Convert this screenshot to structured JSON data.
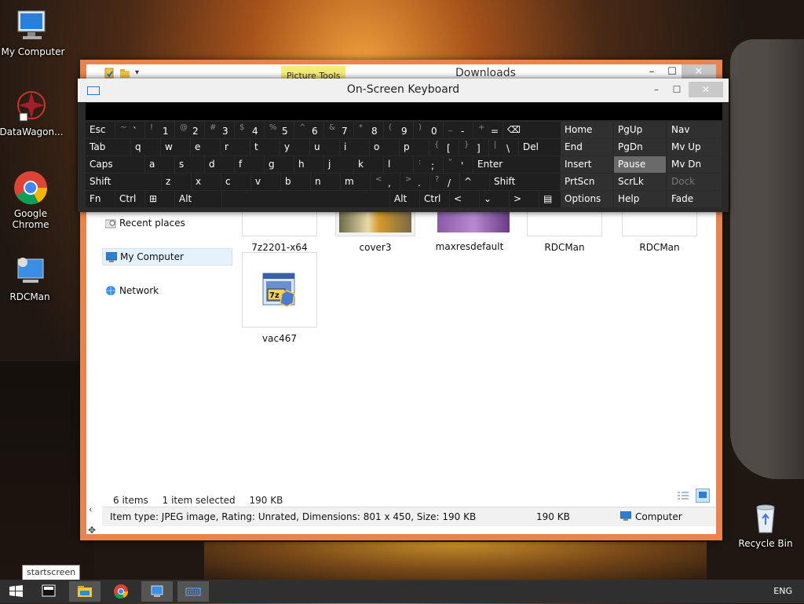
{
  "desktop": {
    "icons": [
      {
        "label": "My Computer"
      },
      {
        "label": "DataWagon..."
      },
      {
        "label": "Google Chrome"
      },
      {
        "label": "RDCMan"
      },
      {
        "label": "Recycle Bin"
      }
    ]
  },
  "explorer": {
    "title": "Downloads",
    "contextual_tab": "Picture Tools",
    "controls": {
      "minimize": "–",
      "maximize": "☐",
      "close": "✕"
    },
    "nav": [
      {
        "label": "Recent places"
      },
      {
        "label": "My Computer"
      },
      {
        "label": "Network"
      }
    ],
    "files": [
      {
        "name": "7z2201-x64"
      },
      {
        "name": "cover3"
      },
      {
        "name": "maxresdefault"
      },
      {
        "name": "RDCMan"
      },
      {
        "name": "RDCMan"
      },
      {
        "name": "vac467"
      }
    ],
    "status": {
      "items": "6 items",
      "selected": "1 item selected",
      "size": "190 KB"
    },
    "details": {
      "info": "Item type: JPEG image, Rating: Unrated, Dimensions: 801 x 450, Size: 190 KB",
      "size": "190 KB",
      "location": "Computer"
    }
  },
  "osk": {
    "title": "On-Screen Keyboard",
    "controls": {
      "minimize": "–",
      "maximize": "☐",
      "close": "✕"
    },
    "rows": {
      "r1": [
        {
          "s": "",
          "m": "Esc"
        },
        {
          "s": "~",
          "m": "`"
        },
        {
          "s": "!",
          "m": "1"
        },
        {
          "s": "@",
          "m": "2"
        },
        {
          "s": "#",
          "m": "3"
        },
        {
          "s": "$",
          "m": "4"
        },
        {
          "s": "%",
          "m": "5"
        },
        {
          "s": "^",
          "m": "6"
        },
        {
          "s": "&",
          "m": "7"
        },
        {
          "s": "*",
          "m": "8"
        },
        {
          "s": "(",
          "m": "9"
        },
        {
          "s": ")",
          "m": "0"
        },
        {
          "s": "_",
          "m": "-"
        },
        {
          "s": "+",
          "m": "="
        },
        {
          "s": "",
          "m": "⌫"
        }
      ],
      "r2": [
        {
          "s": "",
          "m": "Tab"
        },
        {
          "s": "",
          "m": "q"
        },
        {
          "s": "",
          "m": "w"
        },
        {
          "s": "",
          "m": "e"
        },
        {
          "s": "",
          "m": "r"
        },
        {
          "s": "",
          "m": "t"
        },
        {
          "s": "",
          "m": "y"
        },
        {
          "s": "",
          "m": "u"
        },
        {
          "s": "",
          "m": "i"
        },
        {
          "s": "",
          "m": "o"
        },
        {
          "s": "",
          "m": "p"
        },
        {
          "s": "{",
          "m": "["
        },
        {
          "s": "}",
          "m": "]"
        },
        {
          "s": "|",
          "m": "\\"
        },
        {
          "s": "",
          "m": "Del"
        }
      ],
      "r3": [
        {
          "s": "",
          "m": "Caps"
        },
        {
          "s": "",
          "m": "a"
        },
        {
          "s": "",
          "m": "s"
        },
        {
          "s": "",
          "m": "d"
        },
        {
          "s": "",
          "m": "f"
        },
        {
          "s": "",
          "m": "g"
        },
        {
          "s": "",
          "m": "h"
        },
        {
          "s": "",
          "m": "j"
        },
        {
          "s": "",
          "m": "k"
        },
        {
          "s": "",
          "m": "l"
        },
        {
          "s": ":",
          "m": ";"
        },
        {
          "s": "\"",
          "m": "'"
        },
        {
          "s": "",
          "m": "Enter"
        }
      ],
      "r4": [
        {
          "s": "",
          "m": "Shift"
        },
        {
          "s": "",
          "m": "z"
        },
        {
          "s": "",
          "m": "x"
        },
        {
          "s": "",
          "m": "c"
        },
        {
          "s": "",
          "m": "v"
        },
        {
          "s": "",
          "m": "b"
        },
        {
          "s": "",
          "m": "n"
        },
        {
          "s": "",
          "m": "m"
        },
        {
          "s": "<",
          "m": ","
        },
        {
          "s": ">",
          "m": "."
        },
        {
          "s": "?",
          "m": "/"
        },
        {
          "s": "",
          "m": "^"
        },
        {
          "s": "",
          "m": "Shift"
        }
      ],
      "r5": [
        {
          "s": "",
          "m": "Fn"
        },
        {
          "s": "",
          "m": "Ctrl"
        },
        {
          "s": "",
          "m": "⊞"
        },
        {
          "s": "",
          "m": "Alt"
        },
        {
          "s": "",
          "m": ""
        },
        {
          "s": "",
          "m": "Alt"
        },
        {
          "s": "",
          "m": "Ctrl"
        },
        {
          "s": "",
          "m": "<"
        },
        {
          "s": "",
          "m": "⌄"
        },
        {
          "s": "",
          "m": ">"
        },
        {
          "s": "",
          "m": "▤"
        }
      ]
    },
    "nav_keys": [
      [
        "Home",
        "PgUp",
        "Nav"
      ],
      [
        "End",
        "PgDn",
        "Mv Up"
      ],
      [
        "Insert",
        "Pause",
        "Mv Dn"
      ],
      [
        "PrtScn",
        "ScrLk",
        "Dock"
      ],
      [
        "Options",
        "Help",
        "Fade"
      ]
    ]
  },
  "taskbar": {
    "tooltip": "startscreen",
    "language": "ENG"
  }
}
